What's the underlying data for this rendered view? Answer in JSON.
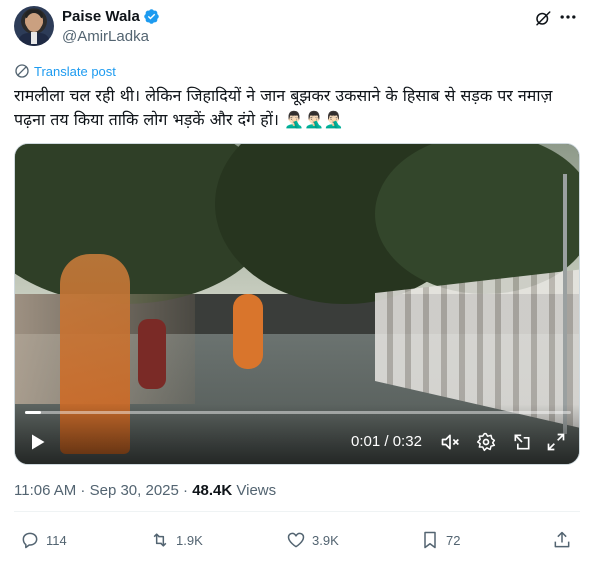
{
  "author": {
    "display_name": "Paise Wala",
    "handle": "@AmirLadka",
    "verified": true
  },
  "header_icons": [
    "grok-icon",
    "more-icon"
  ],
  "translate_label": "Translate post",
  "post": {
    "text": "रामलीला चल रही थी। लेकिन जिहादियों ने जान बूझकर उकसाने के हिसाब से सड़क पर नमाज़ पढ़ना तय किया ताकि लोग भड़कें और दंगे हों। 🤦🏻‍♂️🤦🏻‍♂️🤦🏻‍♂️"
  },
  "video": {
    "current_time": "0:01",
    "separator": " / ",
    "duration": "0:32",
    "progress_fraction": 0.03
  },
  "meta": {
    "time": "11:06 AM",
    "dot": " · ",
    "date": "Sep 30, 2025",
    "views_count": "48.4K",
    "views_label": " Views"
  },
  "actions": {
    "replies": "114",
    "reposts": "1.9K",
    "likes": "3.9K",
    "bookmarks": "72"
  },
  "colors": {
    "accent": "#1d9bf0",
    "secondary_text": "#536471",
    "primary_text": "#0f1419"
  }
}
